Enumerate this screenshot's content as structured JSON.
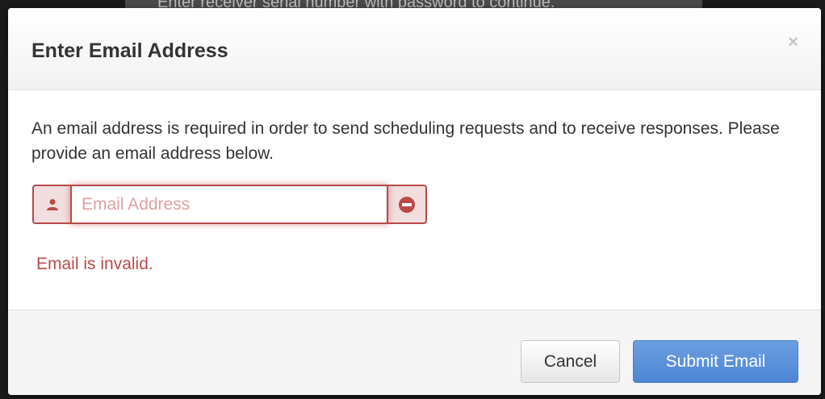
{
  "background": {
    "obscured_text": "Enter receiver serial number with password to continue."
  },
  "modal": {
    "title": "Enter Email Address",
    "close_symbol": "×",
    "description": "An email address is required in order to send scheduling requests and to receive responses. Please provide an email address below.",
    "email_input": {
      "value": "",
      "placeholder": "Email Address",
      "left_icon": "user-icon",
      "right_icon": "minus-circle-icon"
    },
    "error_message": "Email is invalid.",
    "buttons": {
      "cancel_label": "Cancel",
      "submit_label": "Submit Email"
    }
  },
  "colors": {
    "error": "#b94a48",
    "error_bg": "#f2dede",
    "primary": "#5289d8",
    "backdrop": "#1b1b1b"
  }
}
